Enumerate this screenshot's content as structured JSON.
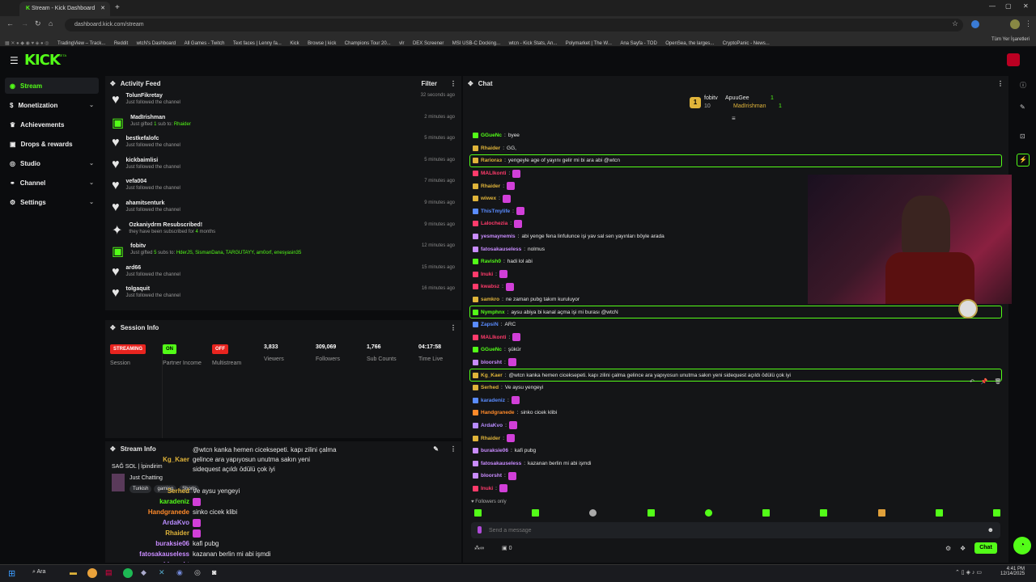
{
  "browser": {
    "tab_title": "Stream - Kick Dashboard",
    "url": "dashboard.kick.com/stream",
    "bookmarks": [
      "TradingView – Track...",
      "Reddit",
      "wtcN's Dashboard",
      "All Games - Twitch",
      "Text faces | Lenny fa...",
      "Kick",
      "Browse | kick",
      "Champions Tour 20...",
      "vlr",
      "DEX Screener",
      "MSI USB-C Docking...",
      "wtcn - Kick Stats, An...",
      "Polymarket | The W...",
      "Ana Sayfa - TOD",
      "OpenSea, the larges...",
      "CryptoPanic - News...",
      "Tüm Yer İşaretleri"
    ]
  },
  "app": {
    "logo": "KICK",
    "logo_sup": "BETA",
    "accent": "#53fc18"
  },
  "sidebar": {
    "items": [
      {
        "label": "Stream",
        "icon": "broadcast-icon",
        "active": true
      },
      {
        "label": "Monetization",
        "icon": "dollar-icon",
        "chevron": true
      },
      {
        "label": "Achievements",
        "icon": "trophy-icon"
      },
      {
        "label": "Drops & rewards",
        "icon": "gift-icon"
      },
      {
        "label": "Studio",
        "icon": "studio-icon",
        "chevron": true
      },
      {
        "label": "Channel",
        "icon": "channel-icon",
        "chevron": true
      },
      {
        "label": "Settings",
        "icon": "gear-icon",
        "chevron": true
      }
    ]
  },
  "activity_feed": {
    "title": "Activity Feed",
    "filter_label": "Filter",
    "items": [
      {
        "name": "TolunFikretay",
        "text": "Just followed the channel",
        "time": "32 seconds ago",
        "icon": "heart-icon"
      },
      {
        "name": "MadIrishman",
        "text_pre": "Just gifted ",
        "count": "1",
        "text_mid": " sub to: ",
        "target": "Rhaider",
        "time": "2 minutes ago",
        "icon": "gift-icon"
      },
      {
        "name": "bestkefalofc",
        "text": "Just followed the channel",
        "time": "5 minutes ago",
        "icon": "heart-icon"
      },
      {
        "name": "kickbaimlisi",
        "text": "Just followed the channel",
        "time": "5 minutes ago",
        "icon": "heart-icon"
      },
      {
        "name": "vefa004",
        "text": "Just followed the channel",
        "time": "7 minutes ago",
        "icon": "heart-icon"
      },
      {
        "name": "ahamitsenturk",
        "text": "Just followed the channel",
        "time": "9 minutes ago",
        "icon": "heart-icon"
      },
      {
        "name": "Ozkaniydrm Resubscribed!",
        "text_pre": "they have been subscribed for ",
        "count": "4",
        "text_mid": " months",
        "time": "9 minutes ago",
        "icon": "star-icon"
      },
      {
        "name": "fobitv",
        "text_pre": "Just gifted ",
        "count": "5",
        "text_mid": " subs to: ",
        "target": "HderJS, SismanDana, TARGUTAYY, am0orf, enesyasin35",
        "time": "12 minutes ago",
        "icon": "gift-icon"
      },
      {
        "name": "ard66",
        "text": "Just followed the channel",
        "time": "15 minutes ago",
        "icon": "heart-icon"
      },
      {
        "name": "tolgaquit",
        "text": "Just followed the channel",
        "time": "16 minutes ago",
        "icon": "heart-icon"
      }
    ]
  },
  "session_info": {
    "title": "Session Info",
    "session_badge": "STREAMING",
    "session_label": "Session",
    "partner_badge": "ON",
    "partner_label": "Partner Income",
    "multistream_badge": "OFF",
    "multistream_label": "Multistream",
    "viewers": "3,833",
    "viewers_label": "Viewers",
    "followers": "309,069",
    "followers_label": "Followers",
    "subs": "1,766",
    "subs_label": "Sub Counts",
    "time_live": "04:17:58",
    "time_live_label": "Time Live"
  },
  "stream_info": {
    "title_label": "Stream Info",
    "stream_title": "SAĞ SOL | İpindirim",
    "category": "Just Chatting",
    "tags": [
      "Turkish",
      "gaming",
      "Shorts"
    ]
  },
  "overlay_chat": [
    {
      "user": "Kg_Kaer",
      "color": "#e0b43a",
      "msg": "@wtcn kanka hemen ciceksepeti. kapı zilini çalma gelince ara yapıyosun unutma sakın yeni sidequest açıldı ödülü çok iyi"
    },
    {
      "user": "Serhed",
      "color": "#e0b43a",
      "msg": "Ve aysu yengeyi"
    },
    {
      "user": "karadeniz",
      "color": "#53fc18",
      "msg": ""
    },
    {
      "user": "Handgranede",
      "color": "#ff8a2a",
      "msg": "sinko cicek klibi"
    },
    {
      "user": "ArdaKvo",
      "color": "#b88cff",
      "msg": ""
    },
    {
      "user": "Rhaider",
      "color": "#e0b43a",
      "msg": ""
    },
    {
      "user": "buraksie06",
      "color": "#c98cff",
      "msg": "kafi pubg"
    },
    {
      "user": "fatosakauseless",
      "color": "#c98cff",
      "msg": "kazanan berlin mi abi işmdi"
    },
    {
      "user": "bloorsht",
      "color": "#c98cff",
      "msg": ""
    }
  ],
  "chat": {
    "title": "Chat",
    "leaderboard": [
      {
        "rank": "1",
        "name": "fobitv",
        "count": "10"
      },
      {
        "name": "ApuuGee",
        "count": "1"
      },
      {
        "name": "MadIrishman",
        "count": "1"
      }
    ],
    "messages": [
      {
        "user": "GGueNc",
        "color": "#53fc18",
        "msg": "byee"
      },
      {
        "user": "Rhaider",
        "color": "#e0b43a",
        "msg": "GG,"
      },
      {
        "user": "Rariorаз",
        "color": "#e0b43a",
        "msg": "yengeyle age of yayını gelir mi bi ara abi @wtcn",
        "hl": true
      },
      {
        "user": "MALIkonti",
        "color": "#ff3b6b",
        "msg": ""
      },
      {
        "user": "Rhaider",
        "color": "#e0b43a",
        "msg": ""
      },
      {
        "user": "wiwex",
        "color": "#e0b43a",
        "msg": ""
      },
      {
        "user": "ThisTmylife",
        "color": "#5a8cff",
        "msg": ""
      },
      {
        "user": "Lalochezia",
        "color": "#ff3b6b",
        "msg": ""
      },
      {
        "user": "yesmaynemis",
        "color": "#c98cff",
        "msg": "abi yenge fena linfulunce işi yav sal sen yayınları böyle arada"
      },
      {
        "user": "fatosakauseless",
        "color": "#c98cff",
        "msg": "nolmus"
      },
      {
        "user": "Ravish0",
        "color": "#53fc18",
        "msg": "hadi lol abi"
      },
      {
        "user": "Inuki",
        "color": "#ff3b6b",
        "msg": ""
      },
      {
        "user": "kwabsz",
        "color": "#ff3b6b",
        "msg": ""
      },
      {
        "user": "samkro",
        "color": "#e0b43a",
        "msg": "ne zaman pubg takım kuruluyor"
      },
      {
        "user": "Nymphnx",
        "color": "#53fc18",
        "msg": "aysu abiya bi kanal açma işi mi burası @wtcN",
        "hl": true
      },
      {
        "user": "ZapsiN",
        "color": "#5a8cff",
        "msg": "ARC"
      },
      {
        "user": "MALIkonti",
        "color": "#ff3b6b",
        "msg": ""
      },
      {
        "user": "GGueNc",
        "color": "#53fc18",
        "msg": "şükür"
      },
      {
        "user": "bloorsht",
        "color": "#c98cff",
        "msg": ""
      },
      {
        "user": "Kg_Kaer",
        "color": "#e0b43a",
        "msg": "@wtcn kanka hemen ciceksepeti. kapı zilini çalma gelince ara yapıyosun unutma sakın yeni sidequest açıldı ödülü çok iyi",
        "hl": true
      },
      {
        "user": "Serhed",
        "color": "#e0b43a",
        "msg": "Ve aysu yengeyi"
      },
      {
        "user": "karadeniz",
        "color": "#5a8cff",
        "msg": ""
      },
      {
        "user": "Handgranede",
        "color": "#ff8a2a",
        "msg": "sinko cicek klibi"
      },
      {
        "user": "ArdaKvo",
        "color": "#b88cff",
        "msg": ""
      },
      {
        "user": "Rhaider",
        "color": "#e0b43a",
        "msg": ""
      },
      {
        "user": "buraksie06",
        "color": "#c98cff",
        "msg": "kafi pubg"
      },
      {
        "user": "fatosakauseless",
        "color": "#c98cff",
        "msg": "kazanan berlin mi abi işmdi"
      },
      {
        "user": "bloorsht",
        "color": "#c98cff",
        "msg": ""
      },
      {
        "user": "Inuki",
        "color": "#ff3b6b",
        "msg": ""
      }
    ],
    "followers_only": "Followers only",
    "input_placeholder": "Send a message",
    "points_count": "0",
    "send_label": "Chat"
  },
  "taskbar": {
    "search_label": "Ara",
    "time": "4:41 PM",
    "date": "12/14/2025"
  }
}
